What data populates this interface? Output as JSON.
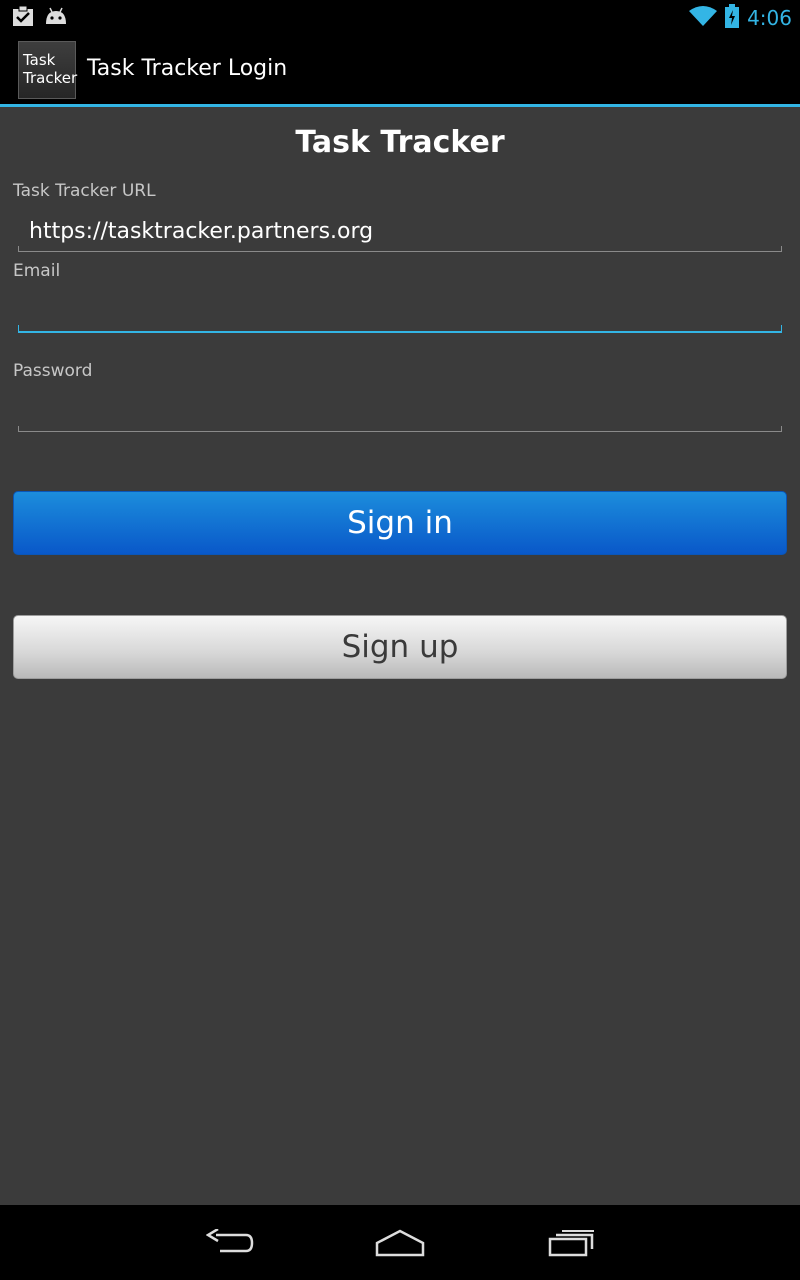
{
  "status_bar": {
    "time": "4:06",
    "icons": [
      "notification-clipboard-icon",
      "android-debug-icon",
      "wifi-icon",
      "battery-charging-icon"
    ]
  },
  "action_bar": {
    "app_icon_line1": "Task",
    "app_icon_line2": "Tracker",
    "title": "Task Tracker Login"
  },
  "form": {
    "heading": "Task Tracker",
    "url_label": "Task Tracker URL",
    "url_value": "https://tasktracker.partners.org",
    "email_label": "Email",
    "email_value": "",
    "password_label": "Password",
    "password_value": ""
  },
  "buttons": {
    "sign_in": "Sign in",
    "sign_up": "Sign up"
  },
  "nav_bar": {
    "icons": [
      "back-icon",
      "home-icon",
      "recent-apps-icon"
    ]
  },
  "colors": {
    "accent": "#33b5e5",
    "background": "#3b3b3b",
    "primary_button": "#0a6fd6"
  }
}
